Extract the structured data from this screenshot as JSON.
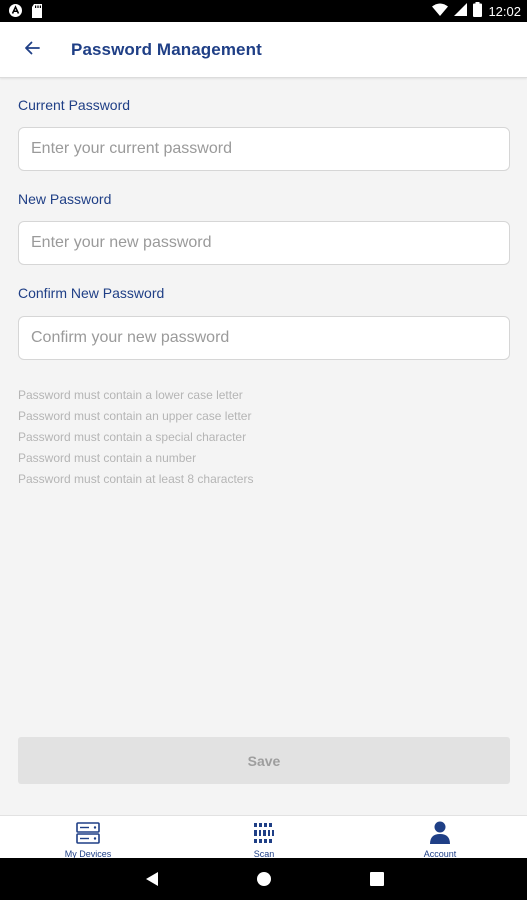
{
  "status_bar": {
    "time": "12:02",
    "left_icons": [
      "app-notification-icon",
      "sd-card-icon"
    ],
    "right_icons": [
      "wifi-icon",
      "signal-icon",
      "battery-icon"
    ]
  },
  "header": {
    "title": "Password Management",
    "back_icon": "arrow-left-icon"
  },
  "form": {
    "current": {
      "label": "Current Password",
      "placeholder": "Enter your current password",
      "value": ""
    },
    "new": {
      "label": "New Password",
      "placeholder": "Enter your new password",
      "value": ""
    },
    "confirm": {
      "label": "Confirm New Password",
      "placeholder": "Confirm your new password",
      "value": ""
    }
  },
  "requirements": [
    "Password must contain a lower case letter",
    "Password must contain an upper case letter",
    "Password must contain a special character",
    "Password must contain a number",
    "Password must contain at least 8 characters"
  ],
  "save_label": "Save",
  "bottom_nav": [
    {
      "label": "My Devices",
      "icon": "devices-icon"
    },
    {
      "label": "Scan",
      "icon": "barcode-icon"
    },
    {
      "label": "Account",
      "icon": "person-icon"
    }
  ],
  "system_nav": [
    "back-triangle-icon",
    "home-circle-icon",
    "recents-square-icon"
  ],
  "colors": {
    "primary": "#1f3f86",
    "background": "#f4f4f4",
    "hint_text": "#b5b5b5",
    "disabled_button": "#e2e2e2"
  }
}
